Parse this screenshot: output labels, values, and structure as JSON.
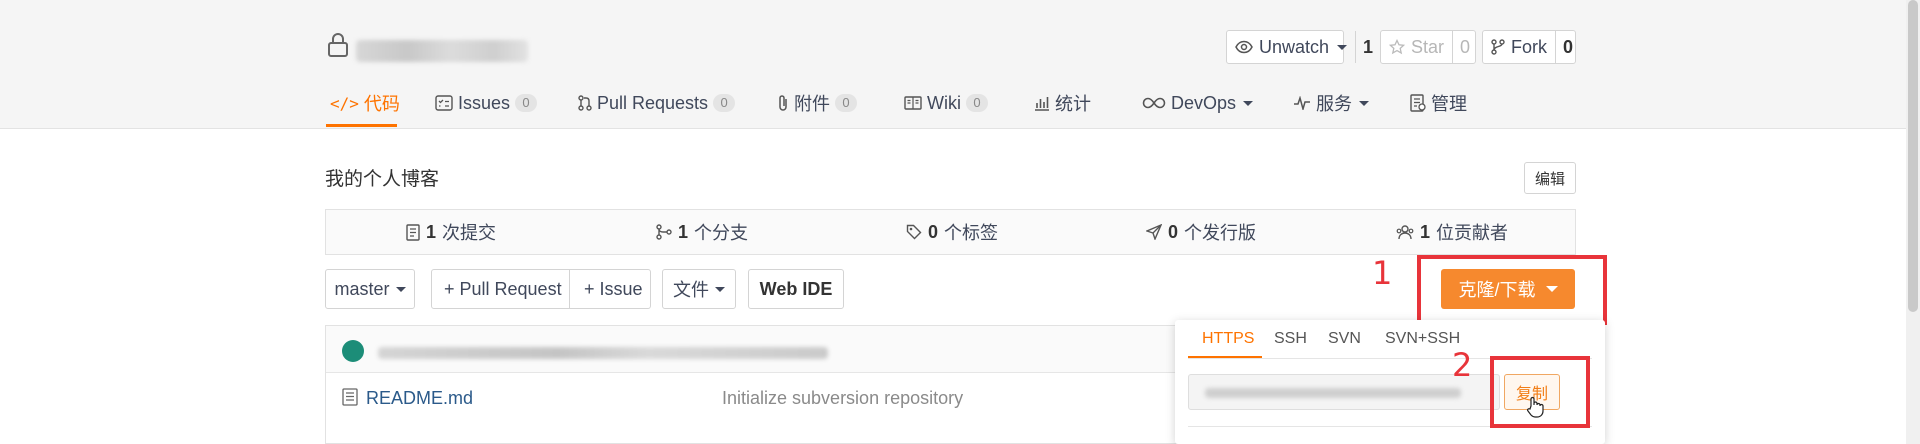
{
  "header": {
    "watch": {
      "label": "Unwatch",
      "count": "1"
    },
    "star": {
      "label": "Star",
      "count": "0"
    },
    "fork": {
      "label": "Fork",
      "count": "0"
    }
  },
  "tabs": [
    {
      "label": "代码",
      "icon": "code-icon"
    },
    {
      "label": "Issues",
      "badge": "0",
      "icon": "issues-icon"
    },
    {
      "label": "Pull Requests",
      "badge": "0",
      "icon": "pull-request-icon"
    },
    {
      "label": "附件",
      "badge": "0",
      "icon": "paperclip-icon"
    },
    {
      "label": "Wiki",
      "badge": "0",
      "icon": "wiki-icon"
    },
    {
      "label": "统计",
      "icon": "bar-chart-icon"
    },
    {
      "label": "DevOps",
      "icon": "infinity-icon"
    },
    {
      "label": "服务",
      "icon": "pulse-icon"
    },
    {
      "label": "管理",
      "icon": "manage-icon"
    }
  ],
  "repo": {
    "description": "我的个人博客",
    "edit_label": "编辑"
  },
  "stats": [
    {
      "value": "1",
      "label": "次提交",
      "icon": "commit-icon"
    },
    {
      "value": "1",
      "label": "个分支",
      "icon": "branch-icon"
    },
    {
      "value": "0",
      "label": "个标签",
      "icon": "tag-icon"
    },
    {
      "value": "0",
      "label": "个发行版",
      "icon": "release-icon"
    },
    {
      "value": "1",
      "label": "位贡献者",
      "icon": "contributors-icon"
    }
  ],
  "toolbar": {
    "branch": "master",
    "pull_request": "+ Pull Request",
    "issue": "+ Issue",
    "file": "文件",
    "web_ide": "Web IDE",
    "clone": "克隆/下载"
  },
  "annotations": {
    "one": "1",
    "two": "2"
  },
  "files": [
    {
      "name": "README.md",
      "message": "Initialize subversion repository"
    }
  ],
  "clone_dropdown": {
    "tabs": [
      "HTTPS",
      "SSH",
      "SVN",
      "SVN+SSH"
    ],
    "active_tab": "HTTPS",
    "copy_label": "复制"
  },
  "colors": {
    "accent": "#fe7300",
    "clone_button": "#f6892e",
    "annotation_red": "#e8343a"
  }
}
